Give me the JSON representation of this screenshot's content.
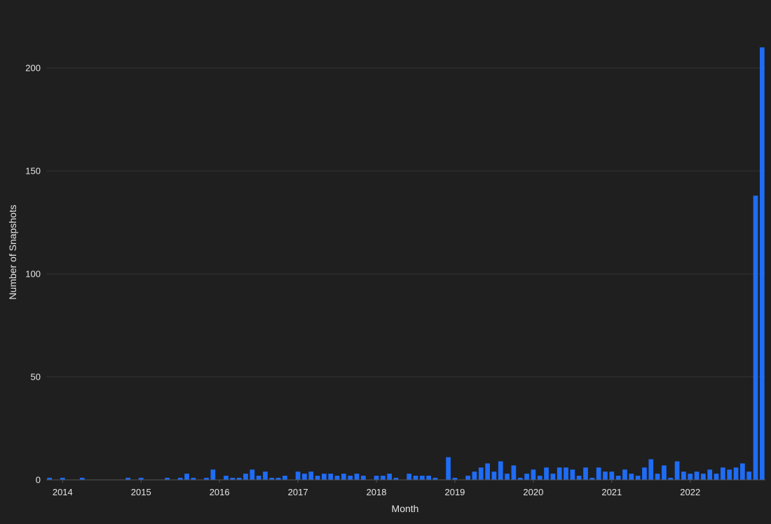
{
  "chart_data": {
    "type": "bar",
    "xlabel": "Month",
    "ylabel": "Number of Snapshots",
    "ylim": [
      0,
      220
    ],
    "y_ticks": [
      0,
      50,
      100,
      150,
      200
    ],
    "x_tick_labels": [
      "2014",
      "2015",
      "2016",
      "2017",
      "2018",
      "2019",
      "2020",
      "2021",
      "2022"
    ],
    "grid": true,
    "bar_color": "#1f6cf5",
    "start_month": "2013-11",
    "values": [
      1,
      0,
      1,
      0,
      0,
      1,
      0,
      0,
      0,
      0,
      0,
      0,
      1,
      0,
      1,
      0,
      0,
      0,
      1,
      0,
      1,
      3,
      1,
      0,
      1,
      5,
      0,
      2,
      1,
      1,
      3,
      5,
      2,
      4,
      1,
      1,
      2,
      0,
      4,
      3,
      4,
      2,
      3,
      3,
      2,
      3,
      2,
      3,
      2,
      0,
      2,
      2,
      3,
      1,
      0,
      3,
      2,
      2,
      2,
      1,
      0,
      11,
      1,
      0,
      2,
      4,
      6,
      8,
      4,
      9,
      3,
      7,
      1,
      3,
      5,
      2,
      6,
      3,
      6,
      6,
      5,
      2,
      6,
      1,
      6,
      4,
      4,
      2,
      5,
      3,
      2,
      6,
      10,
      3,
      7,
      1,
      9,
      4,
      3,
      4,
      3,
      5,
      3,
      6,
      5,
      6,
      8,
      4,
      138,
      210
    ]
  }
}
